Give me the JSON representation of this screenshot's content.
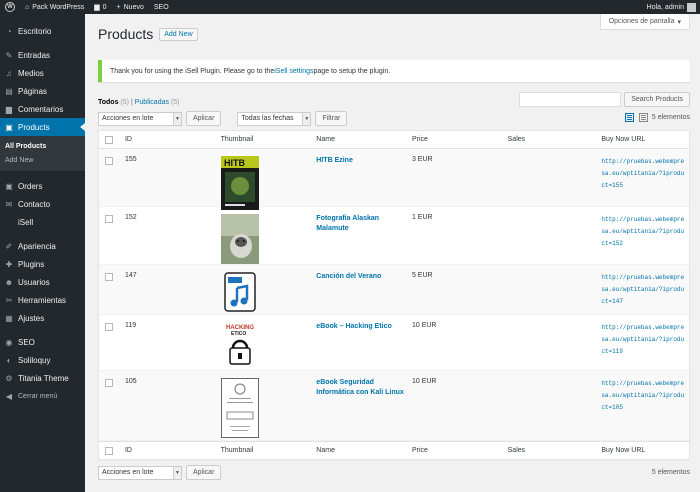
{
  "admin_bar": {
    "site_name": "Pack WordPress",
    "comments_count": "0",
    "new_label": "Nuevo",
    "seo_label": "SEO",
    "greeting": "Hola, admin"
  },
  "sidebar": {
    "items": [
      {
        "label": "Escritorio",
        "icon": "dashboard-icon"
      },
      {
        "label": "Entradas",
        "icon": "pin-icon"
      },
      {
        "label": "Medios",
        "icon": "media-icon"
      },
      {
        "label": "Páginas",
        "icon": "page-icon"
      },
      {
        "label": "Comentarios",
        "icon": "comment-icon"
      },
      {
        "label": "Products",
        "icon": "products-icon",
        "active": true
      },
      {
        "label": "Orders",
        "icon": "orders-icon"
      },
      {
        "label": "Contacto",
        "icon": "mail-icon"
      },
      {
        "label": "iSell",
        "icon": "isell-icon"
      },
      {
        "label": "Apariencia",
        "icon": "brush-icon"
      },
      {
        "label": "Plugins",
        "icon": "plugin-icon"
      },
      {
        "label": "Usuarios",
        "icon": "users-icon"
      },
      {
        "label": "Herramientas",
        "icon": "tools-icon"
      },
      {
        "label": "Ajustes",
        "icon": "settings-icon"
      },
      {
        "label": "SEO",
        "icon": "seo-icon"
      },
      {
        "label": "Soliloquy",
        "icon": "slider-icon"
      },
      {
        "label": "Titania Theme",
        "icon": "theme-icon"
      }
    ],
    "submenu": [
      "All Products",
      "Add New"
    ],
    "collapse_label": "Cerrar menú"
  },
  "screen_options": "Opciones de pantalla",
  "page": {
    "title": "Products",
    "add_new": "Add New"
  },
  "notice": {
    "before": "Thank you for using the iSell Plugin. Please go to the ",
    "link": "iSell settings",
    "after": " page to setup the plugin."
  },
  "filters": {
    "all_label": "Todos",
    "all_count": "(5)",
    "sep": "|",
    "published_label": "Publicadas",
    "published_count": "(5)"
  },
  "search": {
    "button": "Search Products"
  },
  "tablenav": {
    "bulk_action": "Acciones en lote",
    "apply": "Aplicar",
    "date_filter": "Todas las fechas",
    "filter": "Filtrar",
    "items": "5 elementos"
  },
  "table": {
    "columns": [
      "ID",
      "Thumbnail",
      "Name",
      "Price",
      "Sales",
      "Buy Now URL"
    ],
    "rows": [
      {
        "id": "155",
        "name": "HITB Ezine",
        "price": "3 EUR",
        "sales": "",
        "url": "http://pruebas.webempresa.eu/wptitania/?iproduct=155",
        "thumb": "magazine"
      },
      {
        "id": "152",
        "name": "Fotografía Alaskan Malamute",
        "price": "1 EUR",
        "sales": "",
        "url": "http://pruebas.webempresa.eu/wptitania/?iproduct=152",
        "thumb": "photo"
      },
      {
        "id": "147",
        "name": "Canción del Verano",
        "price": "5 EUR",
        "sales": "",
        "url": "http://pruebas.webempresa.eu/wptitania/?iproduct=147",
        "thumb": "audio"
      },
      {
        "id": "119",
        "name": "eBook – Hacking Etico",
        "price": "10 EUR",
        "sales": "",
        "url": "http://pruebas.webempresa.eu/wptitania/?iproduct=119",
        "thumb": "hacking"
      },
      {
        "id": "105",
        "name": "eBook Seguridad Informática con Kali Linux",
        "price": "10 EUR",
        "sales": "",
        "url": "http://pruebas.webempresa.eu/wptitania/?iproduct=105",
        "thumb": "document"
      }
    ]
  },
  "colors": {
    "admin_dark": "#23282d",
    "accent": "#0073aa",
    "notice_green": "#7ad03a"
  }
}
